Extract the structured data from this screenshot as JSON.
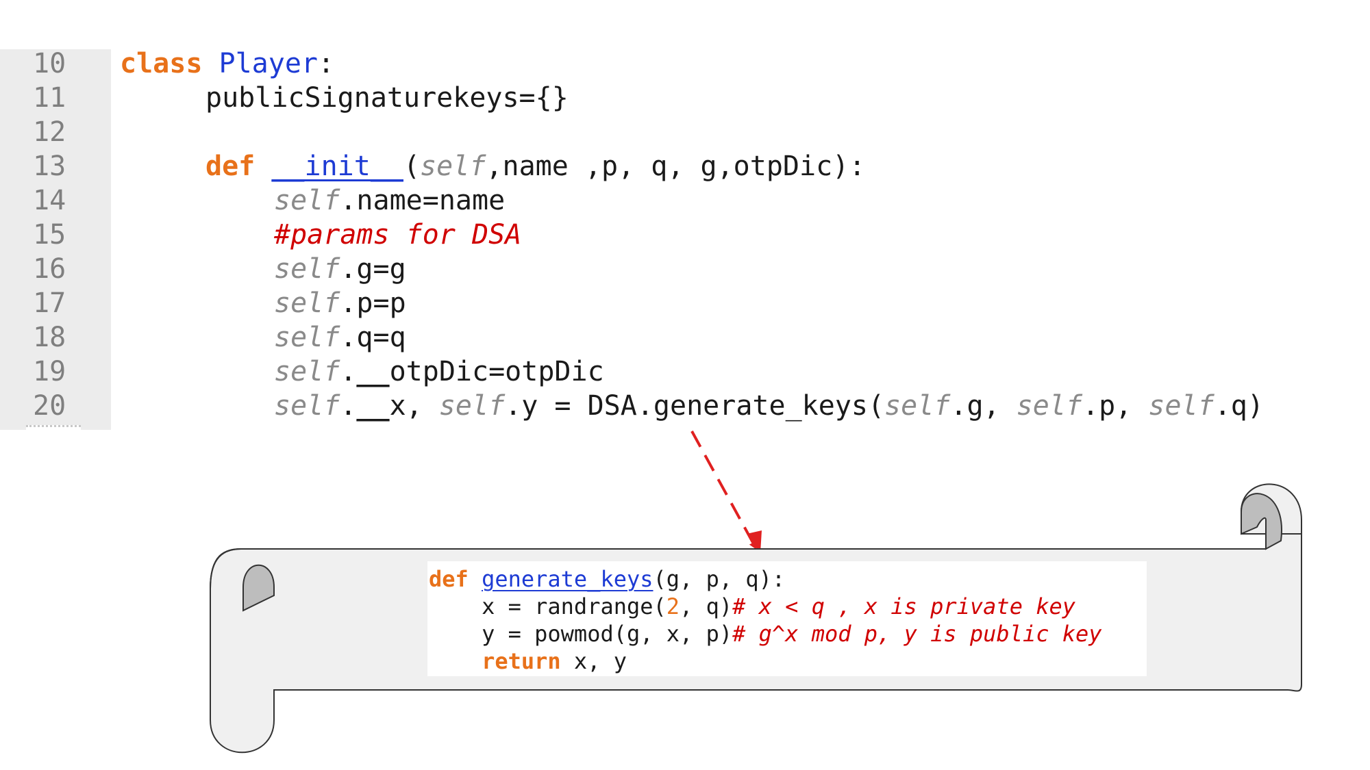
{
  "editor": {
    "lines": [
      {
        "num": "10",
        "tokens": [
          {
            "t": "class",
            "c": "kw"
          },
          {
            "t": " "
          },
          {
            "t": "Player",
            "c": "cls"
          },
          {
            "t": ":"
          }
        ]
      },
      {
        "num": "11",
        "tokens": [
          {
            "t": "publicSignaturekeys={}"
          }
        ]
      },
      {
        "num": "12",
        "tokens": []
      },
      {
        "num": "13",
        "tokens": [
          {
            "t": "def",
            "c": "kw"
          },
          {
            "t": " "
          },
          {
            "t": "__init__",
            "c": "fn"
          },
          {
            "t": "("
          },
          {
            "t": "self",
            "c": "self"
          },
          {
            "t": ",name ,p, q, g,otpDic):"
          }
        ]
      },
      {
        "num": "14",
        "tokens": [
          {
            "t": "self",
            "c": "self"
          },
          {
            "t": ".name=name"
          }
        ]
      },
      {
        "num": "15",
        "tokens": [
          {
            "t": "#params for DSA",
            "c": "comment"
          }
        ]
      },
      {
        "num": "16",
        "tokens": [
          {
            "t": "self",
            "c": "self"
          },
          {
            "t": ".g=g"
          }
        ]
      },
      {
        "num": "17",
        "tokens": [
          {
            "t": "self",
            "c": "self"
          },
          {
            "t": ".p=p"
          }
        ]
      },
      {
        "num": "18",
        "tokens": [
          {
            "t": "self",
            "c": "self"
          },
          {
            "t": ".q=q"
          }
        ]
      },
      {
        "num": "19",
        "tokens": [
          {
            "t": "self",
            "c": "self"
          },
          {
            "t": "."
          },
          {
            "t": "__",
            "c": "dunder-u"
          },
          {
            "t": "otpDic=otpDic"
          }
        ]
      },
      {
        "num": "20",
        "tokens": [
          {
            "t": "self",
            "c": "self"
          },
          {
            "t": "."
          },
          {
            "t": "__",
            "c": "dunder-u"
          },
          {
            "t": "x, "
          },
          {
            "t": "self",
            "c": "self"
          },
          {
            "t": ".y = DSA.generate_keys("
          },
          {
            "t": "self",
            "c": "self"
          },
          {
            "t": ".g, "
          },
          {
            "t": "self",
            "c": "self"
          },
          {
            "t": ".p, "
          },
          {
            "t": "self",
            "c": "self"
          },
          {
            "t": ".q)"
          }
        ]
      }
    ]
  },
  "popup": {
    "lines": [
      {
        "tokens": [
          {
            "t": "def",
            "c": "kw"
          },
          {
            "t": " "
          },
          {
            "t": "generate_keys",
            "c": "fn2"
          },
          {
            "t": "(g, p, q):"
          }
        ]
      },
      {
        "tokens": [
          {
            "t": "    x = randrange("
          },
          {
            "t": "2",
            "c": "num"
          },
          {
            "t": ", q)"
          },
          {
            "t": "# x < q , x is private key",
            "c": "comment"
          }
        ]
      },
      {
        "tokens": [
          {
            "t": "    y = powmod(g, x, p)"
          },
          {
            "t": "# g^x mod p, y is public key",
            "c": "comment"
          }
        ]
      },
      {
        "tokens": [
          {
            "t": "    "
          },
          {
            "t": "return",
            "c": "kw"
          },
          {
            "t": " x, y"
          }
        ]
      }
    ]
  },
  "colors": {
    "keyword": "#e8711a",
    "class_name": "#1d3bd4",
    "self": "#8a8a8a",
    "comment": "#d00000",
    "gutter_bg": "#ececec",
    "scroll_fill": "#f0f0f0",
    "scroll_curl": "#bdbdbd",
    "arrow": "#e02020"
  }
}
